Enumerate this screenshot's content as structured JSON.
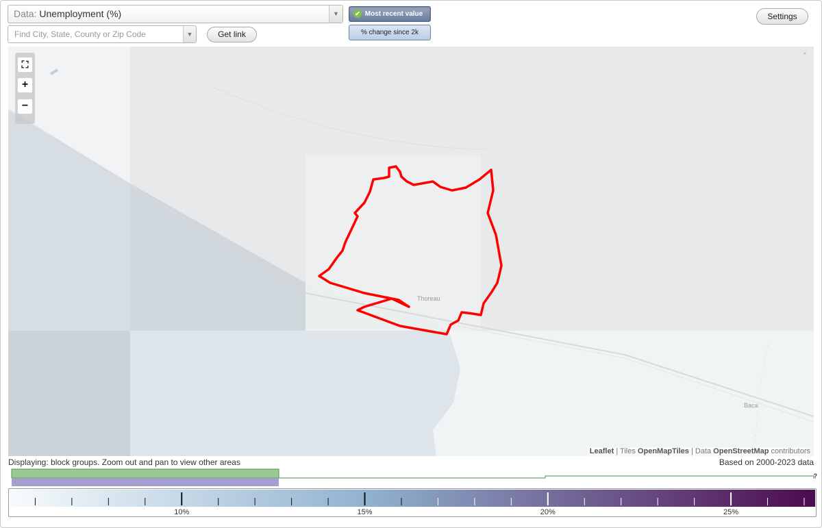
{
  "data_select": {
    "prefix": "Data: ",
    "value": "Unemployment (%)"
  },
  "search": {
    "placeholder": "Find City, State, County or Zip Code"
  },
  "buttons": {
    "get_link": "Get link",
    "settings": "Settings"
  },
  "toggles": {
    "recent": "Most recent value",
    "change": "% change since 2k"
  },
  "zoom": {
    "fullscreen": "⛶",
    "plus": "+",
    "minus": "−"
  },
  "map": {
    "places": {
      "thoreau": "Thoreau",
      "baca": "Baca"
    },
    "boundary_color": "#ff0000"
  },
  "attribution": {
    "leaflet": "Leaflet",
    "sep1": " | Tiles ",
    "tiles": "OpenMapTiles",
    "sep2": " | Data ",
    "osm": "OpenStreetMap",
    "tail": " contributors"
  },
  "status": {
    "displaying": "Displaying: block groups. Zoom out and pan to view other areas",
    "based_on": "Based on 2000-2023 data"
  },
  "legend": {
    "unknown_mark": "?",
    "colors": {
      "low": "#f7fbfd",
      "mid": "#8fb1cf",
      "high": "#4d0a4f"
    },
    "ticks": [
      "10%",
      "15%",
      "20%",
      "25%"
    ],
    "scale_min": 5.3,
    "scale_max": 27.3
  }
}
